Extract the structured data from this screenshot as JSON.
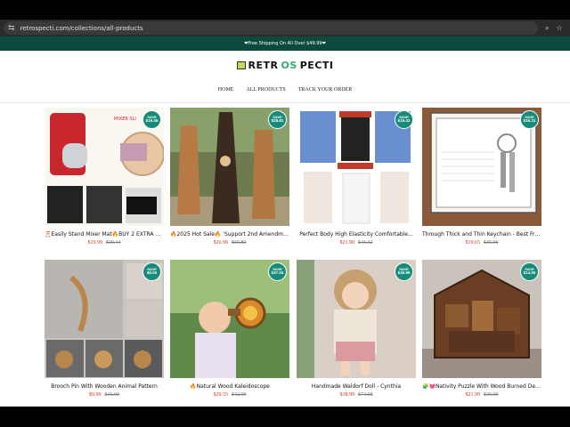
{
  "browser": {
    "url": "retrospecti.com/collections/all-products",
    "icons": [
      "tune-icon",
      "search-icon",
      "star-icon"
    ]
  },
  "announcement": "❤Free Shipping On All Over $49.99❤",
  "logo": {
    "text_left": "RETR",
    "text_mid": "OS",
    "text_right": "PECTI"
  },
  "nav": [
    "HOME",
    "ALL PRODUCTS",
    "TRACK YOUR ORDER"
  ],
  "badge_label": "SAVE",
  "products": [
    {
      "title": "🎅Easily Stand Mixer Mat🔥BUY 2 EXTRA SAV...",
      "price": "$19.99",
      "was": "$39.44",
      "save": "$19.45"
    },
    {
      "title": "🔥2025 Hot Sale🔥 'Support 2nd Amendment'...",
      "price": "$26.99",
      "was": "$55.80",
      "save": "$28.81"
    },
    {
      "title": "Perfect Body High Elasticity Comfortable...",
      "price": "$21.90",
      "was": "$41.32",
      "save": "$19.42"
    },
    {
      "title": "Through Thick and Thin Keychain - Best Frien...",
      "price": "$19.65",
      "was": "$35.96",
      "save": "$16.31"
    },
    {
      "title": "Brooch Pin With Wooden Animal Pattern",
      "price": "$9.99",
      "was": "$16.99",
      "save": "$6.00"
    },
    {
      "title": "🔥Natural Wood Kaleidoscope",
      "price": "$29.55",
      "was": "$42.99",
      "save": "$37.04"
    },
    {
      "title": "Handmade Waldorf Doll - Cynthia",
      "price": "$38.99",
      "was": "$74.98",
      "save": "$35.99"
    },
    {
      "title": "🧩💓Nativity Puzzle With Wood Burned Design...",
      "price": "$21.99",
      "was": "$35.99",
      "save": "$14.00"
    }
  ]
}
